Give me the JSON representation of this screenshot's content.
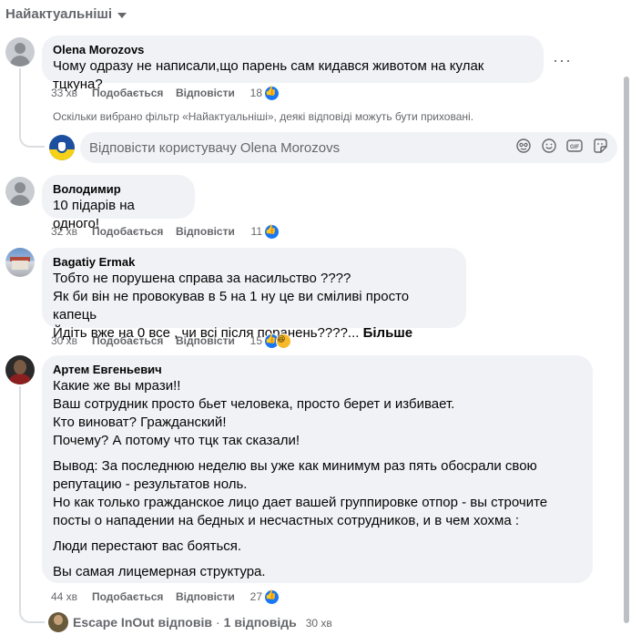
{
  "filter": {
    "label": "Найактуальніші"
  },
  "actions": {
    "like": "Подобається",
    "reply": "Відповісти"
  },
  "comments": [
    {
      "author": "Olena Morozovs",
      "text": "Чому одразу не написали,що парень сам кидався животом на кулак тцкуна?",
      "time": "33 хв",
      "reactions_count": "18",
      "reaction_icons": [
        "like-icon"
      ]
    },
    {
      "author": "Володимир",
      "text": "10 підарів на одного!",
      "time": "32 хв",
      "reactions_count": "11",
      "reaction_icons": [
        "like-icon"
      ]
    },
    {
      "author": "Bagatiy Ermak",
      "lines": [
        "Тобто не порушена справа за насильство ????",
        "Як би він не провокував в 5 на 1 ну це ви сміливі просто капець",
        "Йдіть вже на 0 все , чи всі після поранень????..."
      ],
      "more_label": "Більше",
      "time": "30 хв",
      "reactions_count": "15",
      "reaction_icons": [
        "like-icon",
        "haha-icon"
      ]
    },
    {
      "author": "Артем Евгеньевич",
      "lines_block1": [
        "Какие же вы мрази!!",
        "Ваш сотрудник просто бьет человека, просто берет и избивает.",
        "Кто виноват? Гражданский!",
        "Почему? А потому что тцк так сказали!"
      ],
      "lines_block2": [
        "Вывод: За последнюю неделю вы уже как минимум раз пять обосрали свою",
        "репутацию - результатов ноль.",
        "Но как только гражданское лицо дает вашей группировке отпор - вы строчите",
        "посты о нападении на бедных и несчастных сотрудников, и в чем хохма :"
      ],
      "line_block3": "Люди перестают вас бояться.",
      "line_block4": "Вы самая лицемерная структура.",
      "time": "44 хв",
      "reactions_count": "27",
      "reaction_icons": [
        "like-icon"
      ]
    }
  ],
  "notice": "Оскільки вибрано фільтр «Найактуальніші», деякі відповіді можуть бути приховані.",
  "reply_box": {
    "placeholder": "Відповісти користувачу Olena Morozovs",
    "icons": [
      "sticker-face-icon",
      "emoji-icon",
      "gif-icon",
      "sticker-icon"
    ]
  },
  "replies_summary": {
    "author": "Escape InOut",
    "verb": "відповів",
    "separator": "·",
    "count_label": "1 відповідь",
    "time": "30 хв"
  },
  "colors": {
    "accent": "#1877f2",
    "bubble": "#f0f2f5",
    "secondary_text": "#65676b"
  }
}
